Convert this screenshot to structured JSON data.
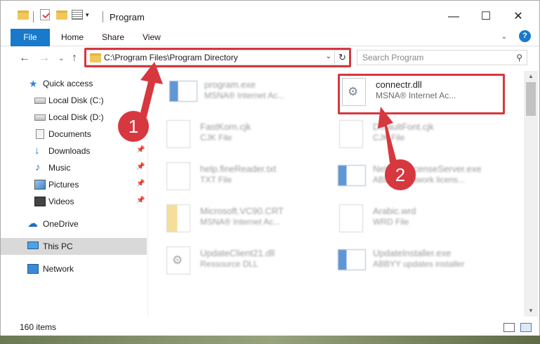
{
  "window": {
    "title": "Program",
    "controls": {
      "minimize": "—",
      "maximize": "☐",
      "close": "✕"
    }
  },
  "ribbon": {
    "tabs": [
      "File",
      "Home",
      "Share",
      "View"
    ],
    "expand": "⌄",
    "help": "?"
  },
  "address": {
    "path": "C:\\Program Files\\Program Directory",
    "dropdown": "⌄",
    "refresh": "↻"
  },
  "search": {
    "placeholder": "Search Program",
    "icon": "search-icon"
  },
  "nav": {
    "back": "←",
    "forward": "→",
    "recent": "⌄",
    "up": "↑"
  },
  "sidebar": {
    "items": [
      {
        "label": "Quick access",
        "icon": "star-icon"
      },
      {
        "label": "Local Disk (C:)",
        "icon": "drive-icon"
      },
      {
        "label": "Local Disk (D:)",
        "icon": "drive-icon"
      },
      {
        "label": "Documents",
        "icon": "documents-icon"
      },
      {
        "label": "Downloads",
        "icon": "downloads-icon",
        "pinned": true
      },
      {
        "label": "Music",
        "icon": "music-icon",
        "pinned": true
      },
      {
        "label": "Pictures",
        "icon": "pictures-icon",
        "pinned": true
      },
      {
        "label": "Videos",
        "icon": "videos-icon",
        "pinned": true
      },
      {
        "label": "OneDrive",
        "icon": "cloud-icon"
      },
      {
        "label": "This PC",
        "icon": "computer-icon",
        "selected": true
      },
      {
        "label": "Network",
        "icon": "network-icon"
      }
    ]
  },
  "files": [
    {
      "name": "program.exe",
      "sub": "MSNA® Internet Ac...",
      "blurred": true
    },
    {
      "name": "connectr.dll",
      "sub": "MSNA® Internet Ac...",
      "blurred": false
    },
    {
      "name": "FastKorn.cjk",
      "sub": "CJK File",
      "blurred": true
    },
    {
      "name": "DefaultFont.cjk",
      "sub": "CJK File",
      "blurred": true
    },
    {
      "name": "help.fineReader.txt",
      "sub": "TXT File",
      "blurred": true
    },
    {
      "name": "NetworkLicenseServer.exe",
      "sub": "ABBYY Network licens...",
      "blurred": true
    },
    {
      "name": "Microsoft.VC90.CRT",
      "sub": "MSNA® Internet Ac...",
      "blurred": true
    },
    {
      "name": "Arabic.wrd",
      "sub": "WRD File",
      "blurred": true
    },
    {
      "name": "UpdateClient21.dll",
      "sub": "Ressource DLL",
      "blurred": true
    },
    {
      "name": "UpdateInstaller.exe",
      "sub": "ABBYY updates installer",
      "blurred": true
    }
  ],
  "status": {
    "count": "160 items"
  },
  "callouts": [
    "1",
    "2"
  ],
  "colors": {
    "accent": "#1979ca",
    "highlight": "#d7373f",
    "selected_bg": "#d9d9d9"
  }
}
